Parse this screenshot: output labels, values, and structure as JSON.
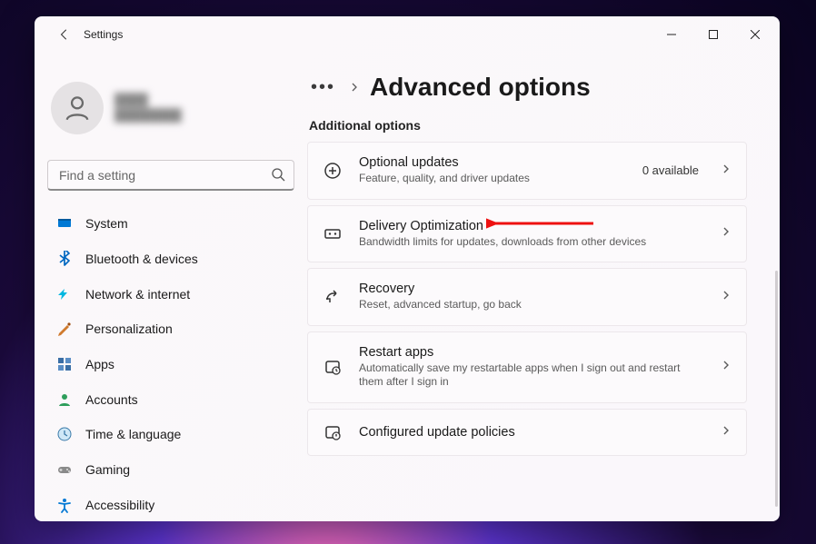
{
  "window": {
    "title": "Settings"
  },
  "profile": {
    "name": "████",
    "email": "████████"
  },
  "search": {
    "placeholder": "Find a setting"
  },
  "nav": [
    {
      "label": "System",
      "icon": "system",
      "color": "#0078d4"
    },
    {
      "label": "Bluetooth & devices",
      "icon": "bluetooth",
      "color": "#0067c0"
    },
    {
      "label": "Network & internet",
      "icon": "wifi",
      "color": "#00a3e0"
    },
    {
      "label": "Personalization",
      "icon": "brush",
      "color": "#d07b2e"
    },
    {
      "label": "Apps",
      "icon": "apps",
      "color": "#3a6ea5"
    },
    {
      "label": "Accounts",
      "icon": "person",
      "color": "#2e9e5b"
    },
    {
      "label": "Time & language",
      "icon": "clock",
      "color": "#5aa0d8"
    },
    {
      "label": "Gaming",
      "icon": "gamepad",
      "color": "#7a7a7a"
    },
    {
      "label": "Accessibility",
      "icon": "accessibility",
      "color": "#0078d4"
    }
  ],
  "page": {
    "title": "Advanced options",
    "section": "Additional options"
  },
  "cards": [
    {
      "title": "Optional updates",
      "sub": "Feature, quality, and driver updates",
      "right": "0 available",
      "icon": "pluscircle"
    },
    {
      "title": "Delivery Optimization",
      "sub": "Bandwidth limits for updates, downloads from other devices",
      "right": "",
      "icon": "delivery"
    },
    {
      "title": "Recovery",
      "sub": "Reset, advanced startup, go back",
      "right": "",
      "icon": "recovery"
    },
    {
      "title": "Restart apps",
      "sub": "Automatically save my restartable apps when I sign out and restart them after I sign in",
      "right": "",
      "icon": "restart"
    },
    {
      "title": "Configured update policies",
      "sub": "",
      "right": "",
      "icon": "policies"
    }
  ]
}
